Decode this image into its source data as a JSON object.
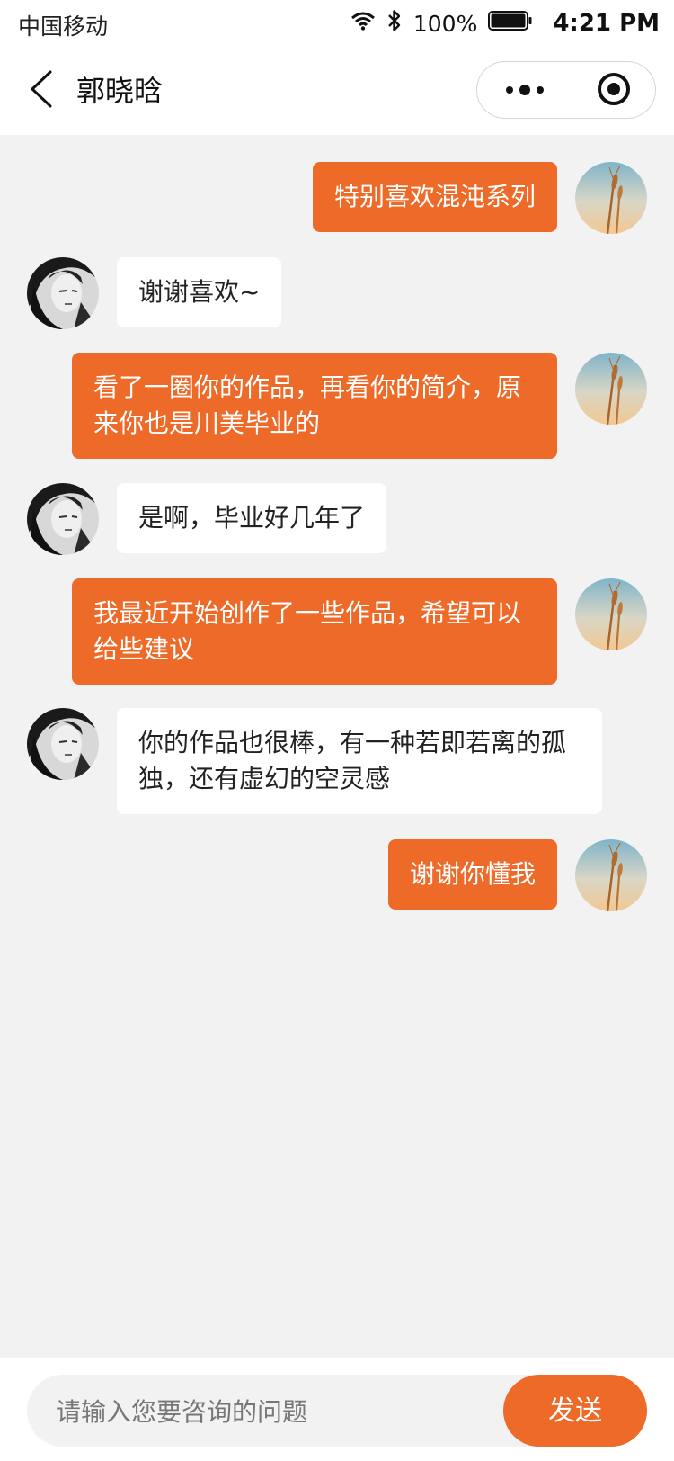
{
  "status_bar": {
    "carrier": "中国移动",
    "battery_percent": "100%",
    "time": "4:21 PM"
  },
  "nav": {
    "title": "郭晓晗",
    "back_icon": "chevron-left-icon",
    "more_icon": "more-dots-icon",
    "target_icon": "target-icon"
  },
  "messages": [
    {
      "side": "right",
      "text": "特别喜欢混沌系列"
    },
    {
      "side": "left",
      "text": "谢谢喜欢~"
    },
    {
      "side": "right",
      "text": "看了一圈你的作品，再看你的简介，原来你也是川美毕业的"
    },
    {
      "side": "left",
      "text": "是啊，毕业好几年了"
    },
    {
      "side": "right",
      "text": "我最近开始创作了一些作品，希望可以给些建议"
    },
    {
      "side": "left",
      "text": "你的作品也很棒，有一种若即若离的孤独，还有虚幻的空灵感"
    },
    {
      "side": "right",
      "text": "谢谢你懂我"
    }
  ],
  "input_bar": {
    "placeholder": "请输入您要咨询的问题",
    "send_label": "发送"
  },
  "colors": {
    "accent": "#ee6a28",
    "background": "#f2f2f2",
    "bubble_left": "#ffffff"
  }
}
